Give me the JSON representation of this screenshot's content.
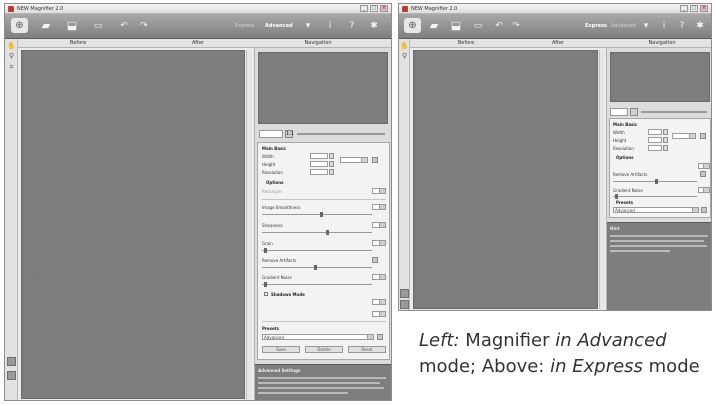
{
  "left_window": {
    "title": "NEW Magnifier 2.0",
    "mode_advanced": "Advanced",
    "mode_express": "Express",
    "headers": [
      "Before",
      "After",
      "Navigation"
    ],
    "zoom_btn": "1:1",
    "settings": {
      "main_basic": "Main Basic",
      "width": "Width",
      "height": "Height",
      "resolution": "Resolution",
      "width_value": "100",
      "height_value": "100",
      "res_value": "72",
      "options": "Options",
      "resample_label": "Resample",
      "image_smoothness": "Image Smoothness",
      "sharpness": "Sharpness",
      "grain": "Grain",
      "artifacts": "Remove Artifacts",
      "gradient": "Gradient Noise",
      "shadows": "Shadows Mode",
      "presets": "Presets",
      "presets_value": "Advanced",
      "btn1": "Save",
      "btn2": "Delete",
      "btn3": "Reset"
    },
    "help_title": "Advanced Settings"
  },
  "right_window": {
    "title": "NEW Magnifier 2.0",
    "mode_advanced": "Advanced",
    "mode_express": "Express",
    "headers": [
      "Before",
      "After",
      "Navigation"
    ],
    "settings": {
      "main_basic": "Main Basic",
      "width": "Width",
      "height": "Height",
      "resolution": "Resolution",
      "options": "Options",
      "remove_artifacts": "Remove Artifacts",
      "gradient_noise": "Gradient Noise",
      "presets": "Presets",
      "presets_value": "Advanced",
      "help_title": "Hint"
    }
  },
  "caption": {
    "part1": "Left:",
    "part2": " Magnifier ",
    "part3": "in Advanced",
    "part4": "mode; Above: ",
    "part5": "in Express",
    "part6": " mode"
  }
}
